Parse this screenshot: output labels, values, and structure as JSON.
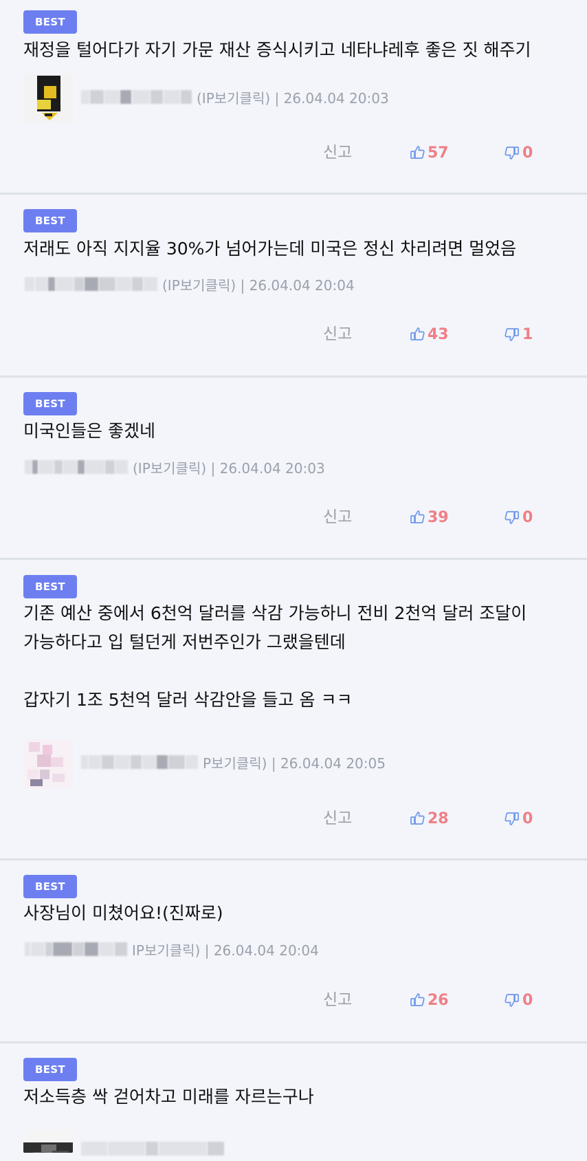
{
  "comments": [
    {
      "badge": "BEST",
      "text": "재정을 털어다가 자기 가문 재산 증식시키고 네타냐레후 좋은 짓 해주기",
      "meta_suffix": "(IP보기클릭) | 26.04.04 20:03",
      "report_label": "신고",
      "upvotes": "57",
      "downvotes": "0",
      "has_avatar": true
    },
    {
      "badge": "BEST",
      "text": "저래도 아직 지지율 30%가 넘어가는데 미국은 정신 차리려면 멀었음",
      "meta_suffix": "(IP보기클릭) | 26.04.04 20:04",
      "report_label": "신고",
      "upvotes": "43",
      "downvotes": "1",
      "has_avatar": false
    },
    {
      "badge": "BEST",
      "text": "미국인들은 좋겠네",
      "meta_suffix": "(IP보기클릭) | 26.04.04 20:03",
      "report_label": "신고",
      "upvotes": "39",
      "downvotes": "0",
      "has_avatar": false
    },
    {
      "badge": "BEST",
      "text": "기존 예산 중에서 6천억 달러를 삭감 가능하니 전비 2천억 달러 조달이\n가능하다고 입 털던게 저번주인가 그랬을텐데\n\n갑자기 1조 5천억 달러 삭감안을 들고 옴 ㅋㅋ",
      "meta_suffix": "P보기클릭) | 26.04.04 20:05",
      "report_label": "신고",
      "upvotes": "28",
      "downvotes": "0",
      "has_avatar": true
    },
    {
      "badge": "BEST",
      "text": "사장님이 미쳤어요!(진짜로)",
      "meta_suffix": "IP보기클릭) | 26.04.04 20:04",
      "report_label": "신고",
      "upvotes": "26",
      "downvotes": "0",
      "has_avatar": false
    },
    {
      "badge": "BEST",
      "text": "저소득층 싹 걷어차고 미래를 자르는구나",
      "meta_suffix": "",
      "report_label": "",
      "upvotes": "",
      "downvotes": "",
      "has_avatar": true
    }
  ],
  "icons": {
    "upvote": "thumbs-up-icon",
    "downvote": "thumbs-down-icon"
  },
  "colors": {
    "background": "#f3f5fb",
    "badge": "#6d7ff0",
    "accent_count": "#f07f86",
    "thumb_icon": "#6d96ea",
    "muted_text": "#9aa0aa",
    "divider": "#dde1e8"
  }
}
